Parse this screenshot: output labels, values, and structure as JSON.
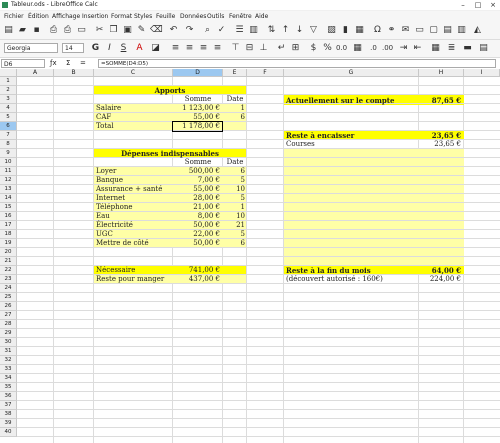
{
  "window": {
    "title": "Tableur.ods - LibreOffice Calc"
  },
  "menu": [
    "Fichier",
    "Édition",
    "Affichage",
    "Insertion",
    "Format",
    "Styles",
    "Feuille",
    "Données",
    "Outils",
    "Fenêtre",
    "Aide"
  ],
  "toolbar": {
    "font_name": "Georgia",
    "font_size": "14"
  },
  "formula_bar": {
    "cell_ref": "D6",
    "formula": "=SOMME(D4:D5)"
  },
  "columns": [
    "A",
    "B",
    "C",
    "D",
    "E",
    "F",
    "G",
    "H",
    "I"
  ],
  "selected": {
    "column": "D",
    "row": "6"
  },
  "rows": [
    "1",
    "2",
    "3",
    "4",
    "5",
    "6",
    "7",
    "8",
    "9",
    "10",
    "11",
    "12",
    "13",
    "14",
    "15",
    "16",
    "17",
    "18",
    "19",
    "20",
    "21",
    "22",
    "23",
    "24",
    "25",
    "26",
    "27",
    "28",
    "29",
    "30",
    "31",
    "32",
    "33",
    "34",
    "35",
    "36",
    "37",
    "38",
    "39",
    "40"
  ],
  "apports": {
    "title": "Apports",
    "somme_header": "Somme",
    "date_header": "Date",
    "rows": [
      {
        "label": "Salaire",
        "amount": "1 123,00 €",
        "date": "1"
      },
      {
        "label": "CAF",
        "amount": "55,00 €",
        "date": "6"
      },
      {
        "label": "Total",
        "amount": "1 178,00 €",
        "date": ""
      }
    ]
  },
  "depenses": {
    "title": "Dépenses indispensables",
    "somme_header": "Somme",
    "date_header": "Date",
    "rows": [
      {
        "label": "Loyer",
        "amount": "500,00 €",
        "date": "6"
      },
      {
        "label": "Banque",
        "amount": "7,00 €",
        "date": "5"
      },
      {
        "label": "Assurance + santé",
        "amount": "55,00 €",
        "date": "10"
      },
      {
        "label": "Internet",
        "amount": "28,00 €",
        "date": "5"
      },
      {
        "label": "Téléphone",
        "amount": "21,00 €",
        "date": "1"
      },
      {
        "label": "Eau",
        "amount": "8,00 €",
        "date": "10"
      },
      {
        "label": "Électricité",
        "amount": "50,00 €",
        "date": "21"
      },
      {
        "label": "UGC",
        "amount": "22,00 €",
        "date": "5"
      },
      {
        "label": "Mettre de côté",
        "amount": "50,00 €",
        "date": "6"
      }
    ],
    "necessaire": {
      "label": "Nécessaire",
      "amount": "741,00 €"
    },
    "reste": {
      "label": "Reste pour manger",
      "amount": "437,00 €"
    }
  },
  "right": {
    "actuellement": {
      "label": "Actuellement sur le compte",
      "amount": "87,65 €"
    },
    "reste_encaisser": {
      "label": "Reste à encaisser",
      "amount": "23,65 €"
    },
    "courses": {
      "label": "Courses",
      "amount": "23,65 €"
    },
    "reste_fin": {
      "label": "Reste à la fin du mois",
      "amount": "64,00 €"
    },
    "decouvert": {
      "label": "(découvert autorisé : 160€)",
      "amount": "224,00 €"
    }
  },
  "colors": {
    "yellow": "#ffff00",
    "pale_yellow": "#ffffa6",
    "selection": "#9cc8f0"
  }
}
